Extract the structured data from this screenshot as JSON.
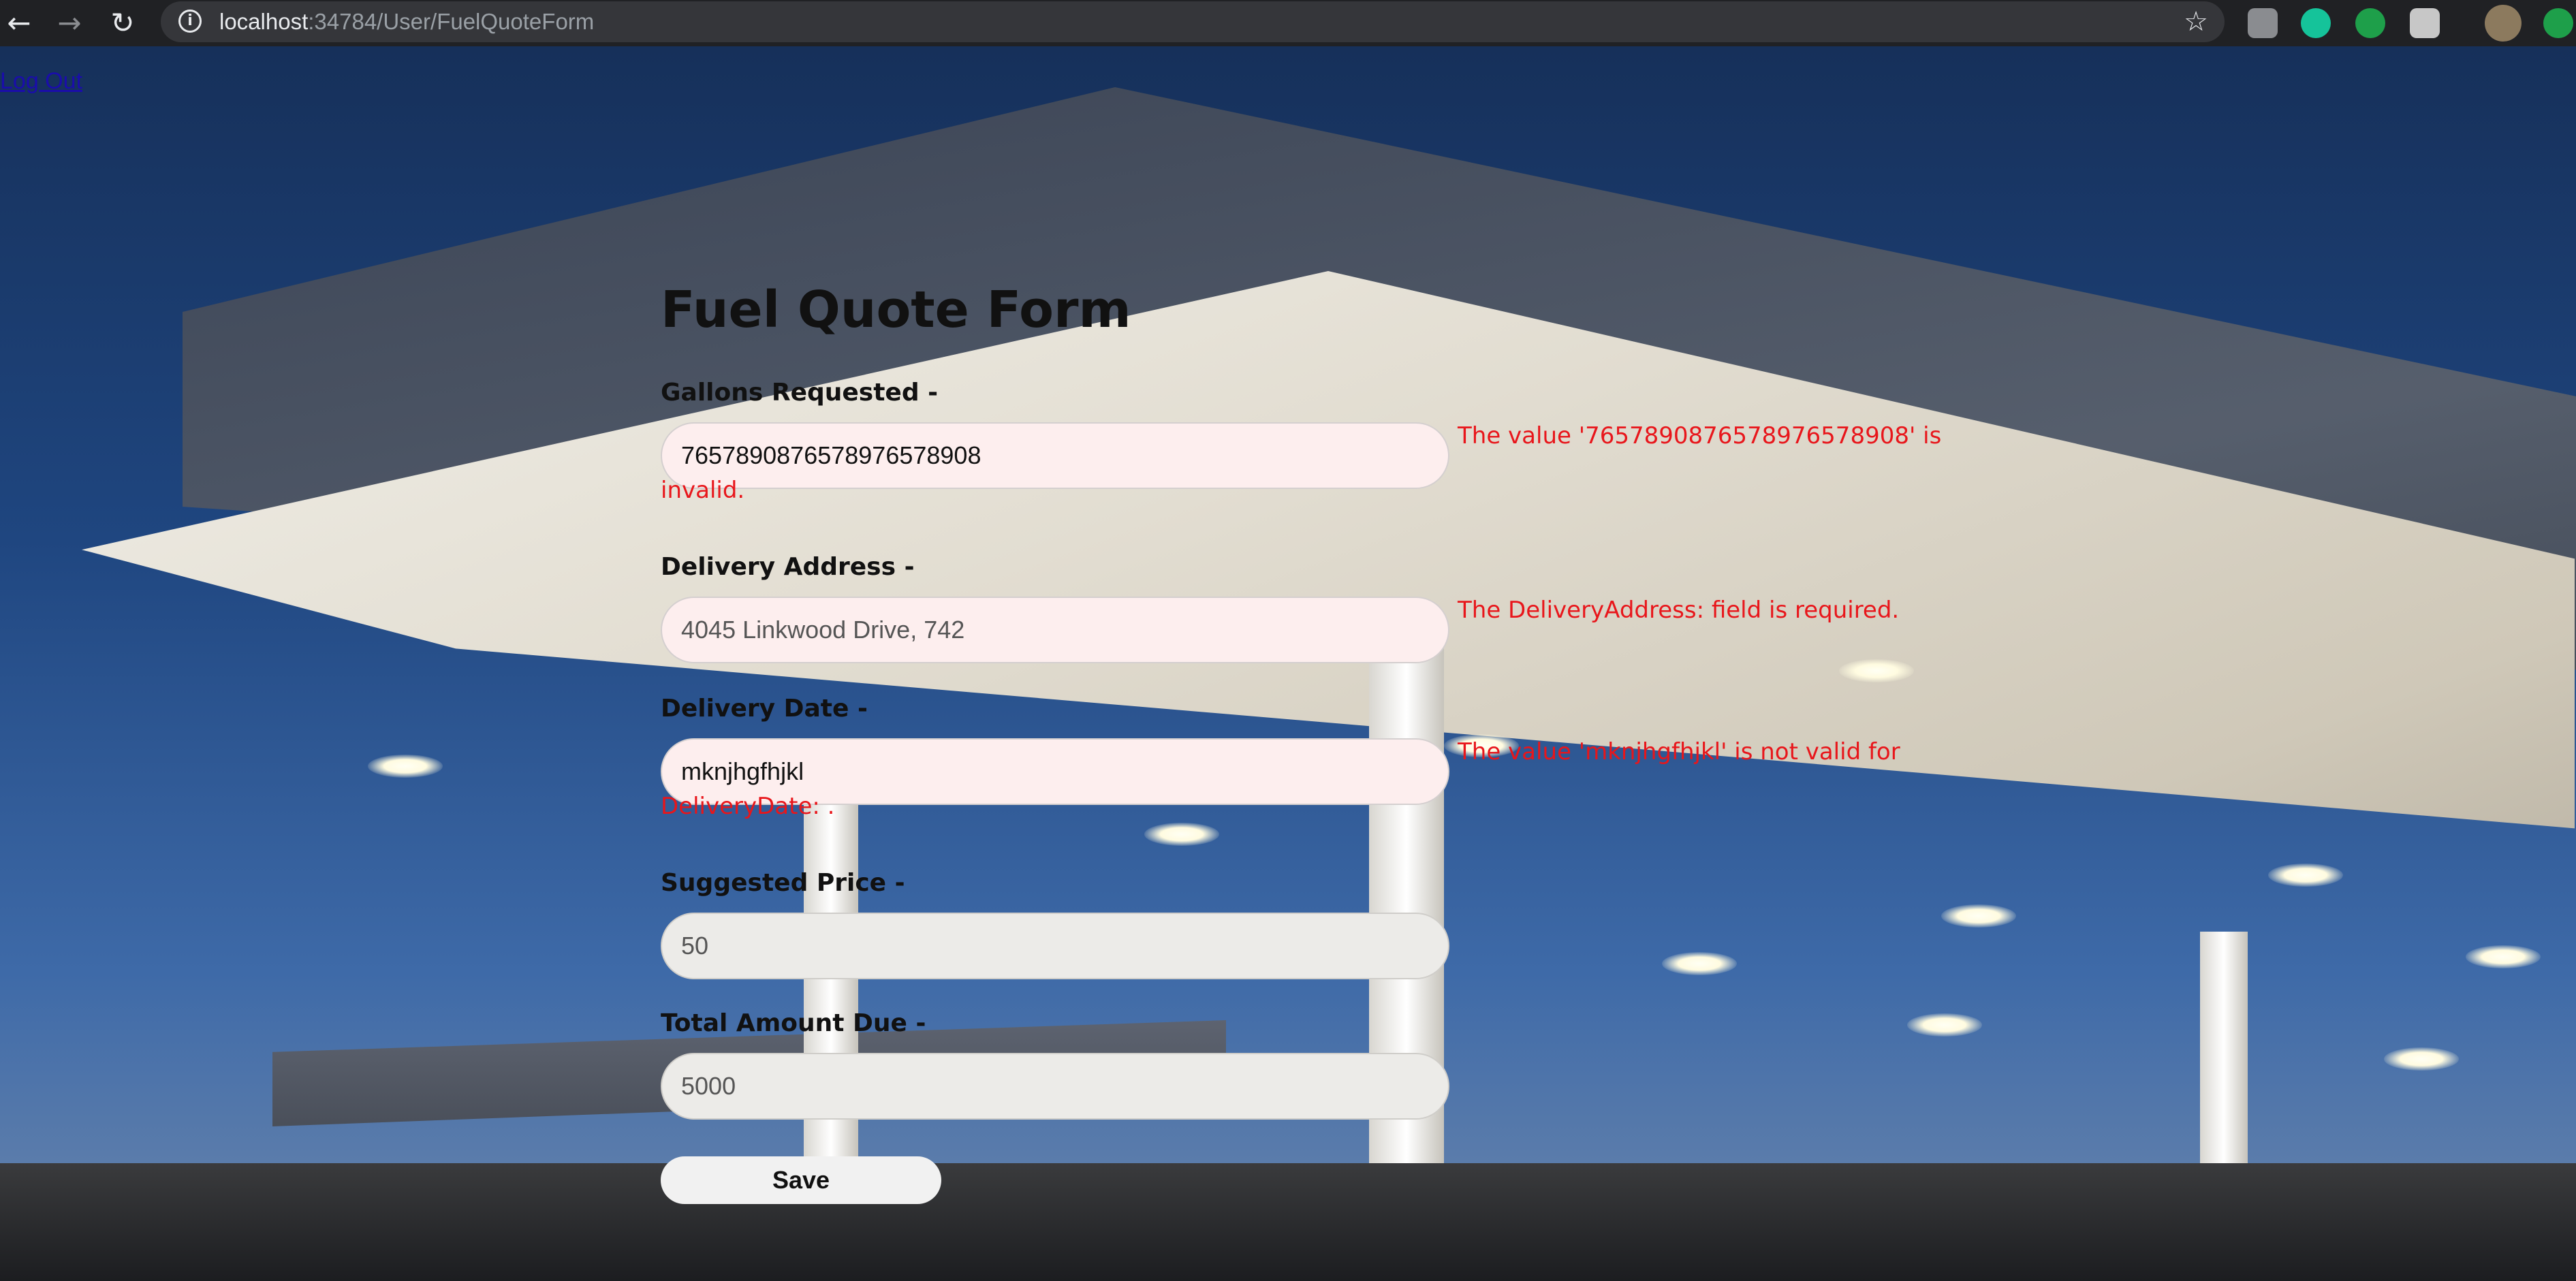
{
  "browser": {
    "url_host": "localhost",
    "url_rest": ":34784/User/FuelQuoteForm"
  },
  "page": {
    "logout_label": "Log Out",
    "title": "Fuel Quote Form",
    "fields": {
      "gallons": {
        "label": "Gallons Requested -",
        "value": "765789087657897657890​8",
        "error_line1": "The value '76578908765789765789​08' is",
        "error_line2": "invalid."
      },
      "address": {
        "label": "Delivery Address -",
        "value": "4045 Linkwood Drive, 742",
        "error": "The DeliveryAddress: field is required."
      },
      "date": {
        "label": "Delivery Date -",
        "value": "mknjhgfhjkl",
        "error_line1": "The value 'mknjhgfhjkl' is not valid for",
        "error_line2": "DeliveryDate: ."
      },
      "price": {
        "label": "Suggested Price -",
        "value": "50"
      },
      "total": {
        "label": "Total Amount Due -",
        "value": "5000"
      }
    },
    "save_label": "Save"
  }
}
